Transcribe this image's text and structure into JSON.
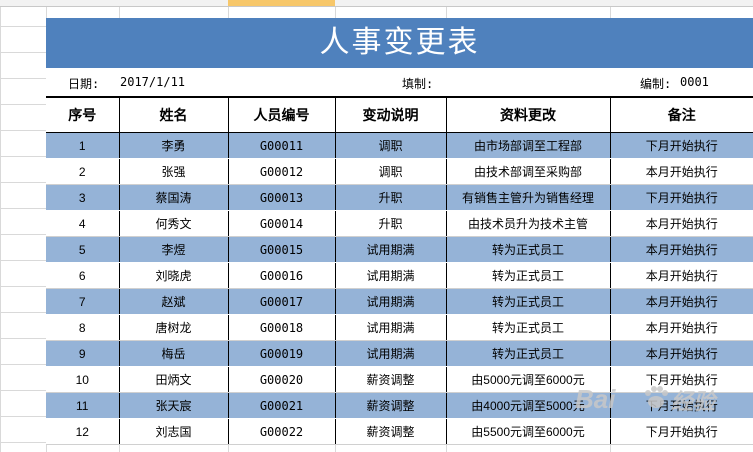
{
  "title": "人事变更表",
  "info": {
    "date_label": "日期:",
    "date_value": "2017/1/11",
    "filler_label": "填制:",
    "code_label": "编制:",
    "code_value": "0001"
  },
  "headers": [
    "序号",
    "姓名",
    "人员编号",
    "变动说明",
    "资料更改",
    "备注"
  ],
  "rows": [
    {
      "no": "1",
      "name": "李勇",
      "id": "G00011",
      "change": "调职",
      "detail": "由市场部调至工程部",
      "note": "下月开始执行"
    },
    {
      "no": "2",
      "name": "张强",
      "id": "G00012",
      "change": "调职",
      "detail": "由技术部调至采购部",
      "note": "本月开始执行"
    },
    {
      "no": "3",
      "name": "蔡国涛",
      "id": "G00013",
      "change": "升职",
      "detail": "有销售主管升为销售经理",
      "note": "下月开始执行"
    },
    {
      "no": "4",
      "name": "何秀文",
      "id": "G00014",
      "change": "升职",
      "detail": "由技术员升为技术主管",
      "note": "本月开始执行"
    },
    {
      "no": "5",
      "name": "李煜",
      "id": "G00015",
      "change": "试用期满",
      "detail": "转为正式员工",
      "note": "本月开始执行"
    },
    {
      "no": "6",
      "name": "刘晓虎",
      "id": "G00016",
      "change": "试用期满",
      "detail": "转为正式员工",
      "note": "本月开始执行"
    },
    {
      "no": "7",
      "name": "赵斌",
      "id": "G00017",
      "change": "试用期满",
      "detail": "转为正式员工",
      "note": "本月开始执行"
    },
    {
      "no": "8",
      "name": "唐树龙",
      "id": "G00018",
      "change": "试用期满",
      "detail": "转为正式员工",
      "note": "本月开始执行"
    },
    {
      "no": "9",
      "name": "梅岳",
      "id": "G00019",
      "change": "试用期满",
      "detail": "转为正式员工",
      "note": "本月开始执行"
    },
    {
      "no": "10",
      "name": "田炳文",
      "id": "G00020",
      "change": "薪资调整",
      "detail": "由5000元调至6000元",
      "note": "下月开始执行"
    },
    {
      "no": "11",
      "name": "张天宸",
      "id": "G00021",
      "change": "薪资调整",
      "detail": "由4000元调至5000元",
      "note": "下月开始执行"
    },
    {
      "no": "12",
      "name": "刘志国",
      "id": "G00022",
      "change": "薪资调整",
      "detail": "由5500元调至6000元",
      "note": "下月开始执行"
    }
  ],
  "watermark": {
    "left": "Bai",
    "right": "经验"
  },
  "colors": {
    "title_bg": "#4f81bd",
    "band": "#95b3d7"
  }
}
